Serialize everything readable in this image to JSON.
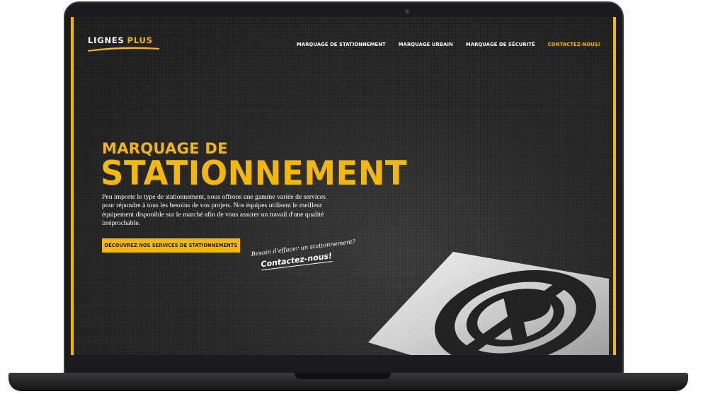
{
  "brand": {
    "name_part1": "LIGNES",
    "name_part2": "PLUS",
    "accent_color": "#f5b800"
  },
  "nav": {
    "items": [
      {
        "label": "MARQUAGE DE STATIONNEMENT"
      },
      {
        "label": "MARQUAGE URBAIN"
      },
      {
        "label": "MARQUAGE DE SÉCURITÉ"
      },
      {
        "label": "CONTACTEZ-NOUS!"
      }
    ]
  },
  "hero": {
    "subtitle": "MARQUAGE DE",
    "title": "STATIONNEMENT",
    "description": "Peu importe le type de stationnement, nous offrons une gamme variée de services pour répondre à tous les besoins de vos projets. Nos équipes utilisent le meilleur équipement disponible sur le marché afin de vous assurer un travail d'une qualité irréprochable.",
    "cta_label": "DÉCOUVREZ NOS SERVICES DE STATIONNEMENTS",
    "note_question": "Besoin d'effacer un stationnement?",
    "note_link": "Contactez-nous!"
  },
  "icons": {
    "stencil": "no-parking-stencil-icon",
    "camera": "camera-icon"
  }
}
